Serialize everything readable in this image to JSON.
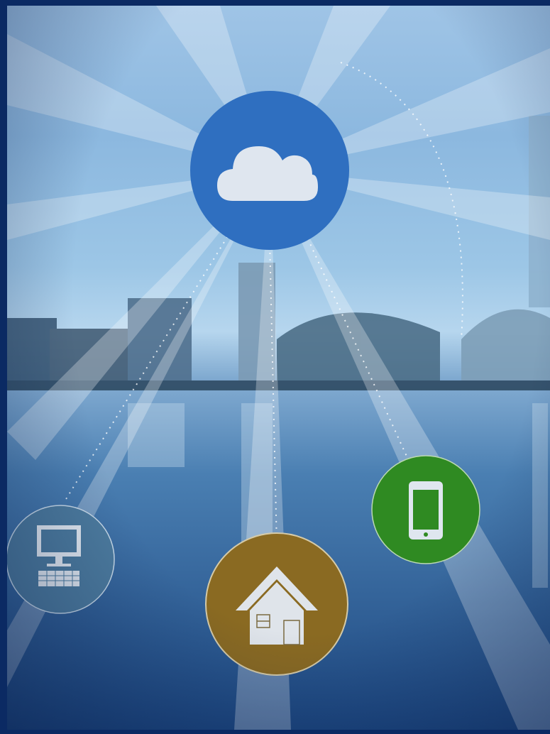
{
  "scene": {
    "icons": [
      {
        "name": "cloud",
        "color": "#2f6fc0"
      },
      {
        "name": "desktop-computer",
        "color": "#4d7c9f"
      },
      {
        "name": "home",
        "color": "#8a6a22"
      },
      {
        "name": "smartphone",
        "color": "#2f8a22"
      }
    ],
    "colors": {
      "border": "#0b2a63",
      "sky": "#9fc4e6",
      "water": "#2a5b93"
    }
  }
}
